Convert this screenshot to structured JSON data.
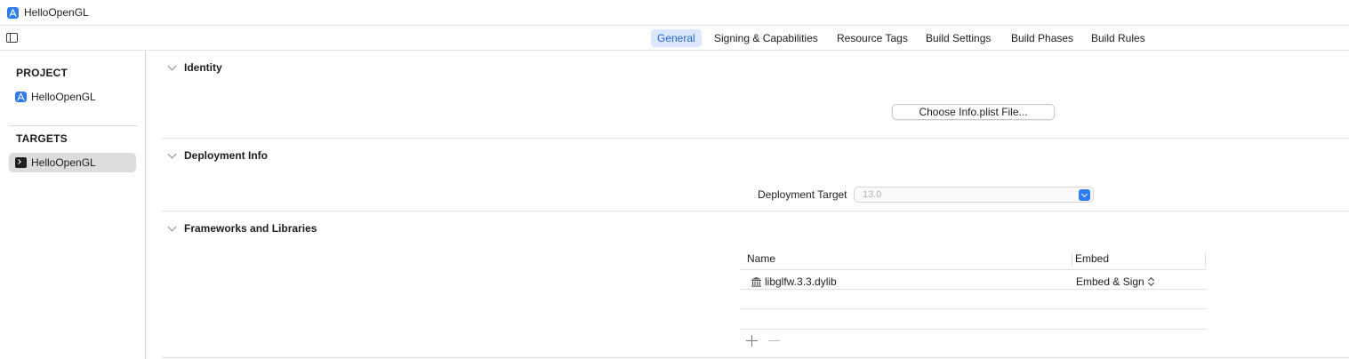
{
  "window": {
    "title": "HelloOpenGL",
    "icon": "xcode-project-icon"
  },
  "tabs": [
    {
      "label": "General",
      "active": true
    },
    {
      "label": "Signing & Capabilities",
      "active": false
    },
    {
      "label": "Resource Tags",
      "active": false
    },
    {
      "label": "Build Settings",
      "active": false
    },
    {
      "label": "Build Phases",
      "active": false
    },
    {
      "label": "Build Rules",
      "active": false
    }
  ],
  "sidebar": {
    "project_header": "PROJECT",
    "project_item": {
      "label": "HelloOpenGL",
      "icon": "xcode-project-icon"
    },
    "targets_header": "TARGETS",
    "target_item": {
      "label": "HelloOpenGL",
      "icon": "terminal-icon",
      "selected": true
    }
  },
  "identity": {
    "title": "Identity",
    "choose_button": "Choose Info.plist File..."
  },
  "deployment": {
    "title": "Deployment Info",
    "target_label": "Deployment Target",
    "target_value": "13.0"
  },
  "frameworks": {
    "title": "Frameworks and Libraries",
    "columns": [
      "Name",
      "Embed"
    ],
    "rows": [
      {
        "name": "libglfw.3.3.dylib",
        "embed": "Embed & Sign",
        "icon": "library-icon"
      }
    ]
  },
  "colors": {
    "accent": "#2c7cf6",
    "tab_active_bg": "#dbe7fb",
    "tab_active_text": "#2164d9",
    "sidebar_selected": "#dcdcdc"
  }
}
